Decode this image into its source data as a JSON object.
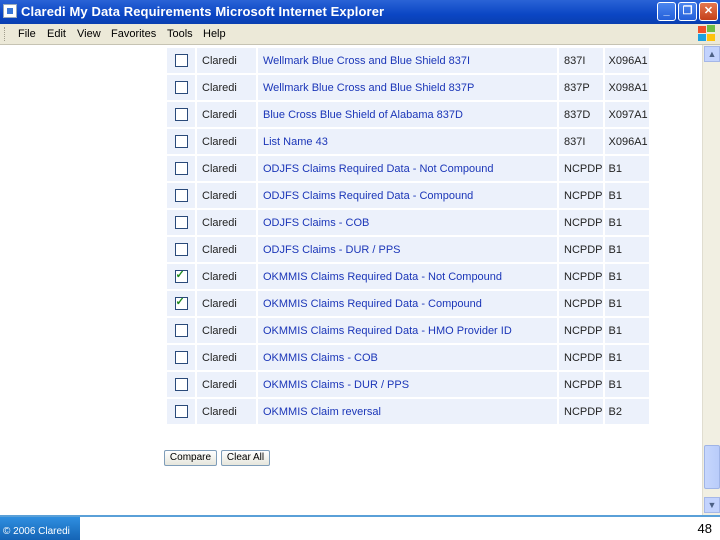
{
  "window": {
    "title": "Claredi  My Data Requirements  Microsoft Internet Explorer"
  },
  "menu": [
    "File",
    "Edit",
    "View",
    "Favorites",
    "Tools",
    "Help"
  ],
  "rows": [
    {
      "checked": false,
      "org": "Claredi",
      "name": "Wellmark Blue Cross and Blue Shield 837I",
      "format": "837I",
      "version": "X096A1"
    },
    {
      "checked": false,
      "org": "Claredi",
      "name": "Wellmark Blue Cross and Blue Shield 837P",
      "format": "837P",
      "version": "X098A1"
    },
    {
      "checked": false,
      "org": "Claredi",
      "name": "Blue Cross Blue Shield of Alabama 837D",
      "format": "837D",
      "version": "X097A1"
    },
    {
      "checked": false,
      "org": "Claredi",
      "name": "List Name 43",
      "format": "837I",
      "version": "X096A1"
    },
    {
      "checked": false,
      "org": "Claredi",
      "name": "ODJFS Claims Required Data - Not Compound",
      "format": "NCPDP",
      "version": "B1"
    },
    {
      "checked": false,
      "org": "Claredi",
      "name": "ODJFS Claims Required Data - Compound",
      "format": "NCPDP",
      "version": "B1"
    },
    {
      "checked": false,
      "org": "Claredi",
      "name": "ODJFS Claims - COB",
      "format": "NCPDP",
      "version": "B1"
    },
    {
      "checked": false,
      "org": "Claredi",
      "name": "ODJFS Claims - DUR / PPS",
      "format": "NCPDP",
      "version": "B1"
    },
    {
      "checked": true,
      "org": "Claredi",
      "name": "OKMMIS Claims Required Data - Not Compound",
      "format": "NCPDP",
      "version": "B1"
    },
    {
      "checked": true,
      "org": "Claredi",
      "name": "OKMMIS Claims Required Data - Compound",
      "format": "NCPDP",
      "version": "B1"
    },
    {
      "checked": false,
      "org": "Claredi",
      "name": "OKMMIS Claims Required Data - HMO Provider ID",
      "format": "NCPDP",
      "version": "B1"
    },
    {
      "checked": false,
      "org": "Claredi",
      "name": "OKMMIS Claims - COB",
      "format": "NCPDP",
      "version": "B1"
    },
    {
      "checked": false,
      "org": "Claredi",
      "name": "OKMMIS Claims - DUR / PPS",
      "format": "NCPDP",
      "version": "B1"
    },
    {
      "checked": false,
      "org": "Claredi",
      "name": "OKMMIS Claim reversal",
      "format": "NCPDP",
      "version": "B2"
    }
  ],
  "buttons": {
    "compare": "Compare",
    "clear_all": "Clear All"
  },
  "footer": {
    "copyright": "© 2006 Claredi",
    "page_number": "48"
  },
  "colors": {
    "titlebar": "#0b46c4",
    "row_bg": "#ecf1fb",
    "link": "#1b36b8",
    "check": "#1f8a1f"
  }
}
